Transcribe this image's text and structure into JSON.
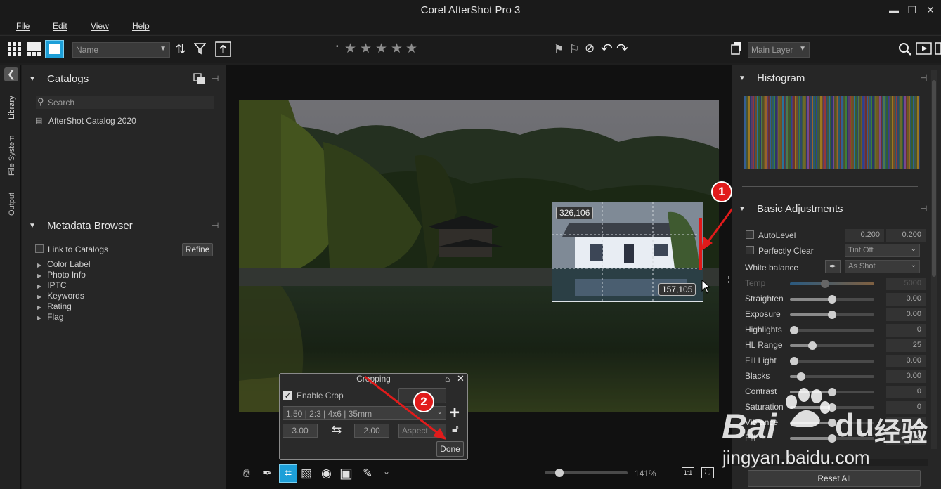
{
  "window": {
    "title": "Corel AfterShot Pro 3",
    "minimize": "▬",
    "maximize": "❐",
    "close": "✕"
  },
  "menu": [
    "File",
    "Edit",
    "View",
    "Help"
  ],
  "toolbar": {
    "sort_select": "Name",
    "layer_select": "Main Layer",
    "swatch_colors": [
      "#9a9a9a",
      "#e00000",
      "#e8e000",
      "#00d000",
      "#0000e8",
      "#e000e0"
    ]
  },
  "left_strip": {
    "tabs": [
      "Library",
      "File System",
      "Output"
    ]
  },
  "catalogs": {
    "title": "Catalogs",
    "search_placeholder": "Search",
    "items": [
      "AfterShot Catalog 2020"
    ]
  },
  "metadata": {
    "title": "Metadata Browser",
    "link_label": "Link to Catalogs",
    "refine_label": "Refine",
    "items": [
      "Color Label",
      "Photo Info",
      "IPTC",
      "Keywords",
      "Rating",
      "Flag"
    ]
  },
  "crop_overlay": {
    "top_left": "326,106",
    "bottom_right": "157,105"
  },
  "annotations": {
    "one": "1",
    "two": "2"
  },
  "cropping": {
    "title": "Cropping",
    "enable_label": "Enable Crop",
    "ratio_select": "1.50 | 2:3 | 4x6 | 35mm",
    "width": "3.00",
    "height": "2.00",
    "aspect_label": "Aspect",
    "done_label": "Done"
  },
  "zoom": {
    "value": "141%",
    "slider_fraction": 0.18
  },
  "histogram": {
    "title": "Histogram"
  },
  "basic": {
    "title": "Basic Adjustments",
    "autolevel_label": "AutoLevel",
    "autolevel_v1": "0.200",
    "autolevel_v2": "0.200",
    "perfectly_clear_label": "Perfectly Clear",
    "tint_select": "Tint Off",
    "white_balance_label": "White balance",
    "wb_select": "As Shot",
    "sliders": [
      {
        "label": "Temp",
        "value": "5000",
        "fraction": 0.42,
        "disabled": true
      },
      {
        "label": "Straighten",
        "value": "0.00",
        "fraction": 0.5
      },
      {
        "label": "Exposure",
        "value": "0.00",
        "fraction": 0.5
      },
      {
        "label": "Highlights",
        "value": "0",
        "fraction": 0.05
      },
      {
        "label": "HL Range",
        "value": "25",
        "fraction": 0.27
      },
      {
        "label": "Fill Light",
        "value": "0.00",
        "fraction": 0.05
      },
      {
        "label": "Blacks",
        "value": "0.00",
        "fraction": 0.13
      },
      {
        "label": "Contrast",
        "value": "0",
        "fraction": 0.5
      },
      {
        "label": "Saturation",
        "value": "0",
        "fraction": 0.5
      },
      {
        "label": "Vibrance",
        "value": "0",
        "fraction": 0.5
      },
      {
        "label": "Fill",
        "value": "0",
        "fraction": 0.5
      }
    ],
    "reset_label": "Reset All"
  },
  "watermark": {
    "brand": "Bai",
    "brand2": "du",
    "cn": "经验",
    "url": "jingyan.baidu.com"
  }
}
